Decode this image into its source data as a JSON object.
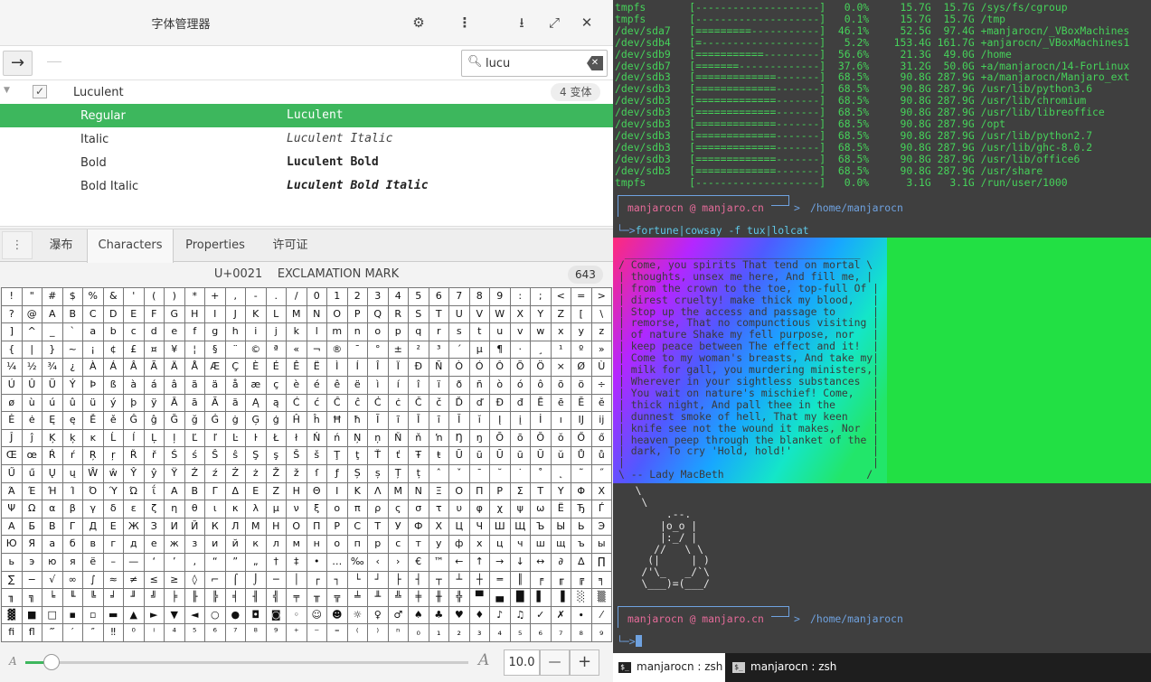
{
  "font_manager": {
    "title": "字体管理器",
    "header_icons": [
      "gear-icon",
      "menu-icon",
      "download-icon",
      "expand-icon",
      "close-icon"
    ],
    "search": {
      "value": "lucu"
    },
    "family": {
      "name": "Luculent",
      "badge": "4 变体",
      "checked": true
    },
    "variants": [
      {
        "style": "Regular",
        "preview": "Luculent",
        "selected": true
      },
      {
        "style": "Italic",
        "preview": "Luculent Italic"
      },
      {
        "style": "Bold",
        "preview": "Luculent Bold"
      },
      {
        "style": "Bold Italic",
        "preview": "Luculent Bold Italic"
      }
    ],
    "tabs": [
      "瀑布",
      "Characters",
      "Properties",
      "许可证"
    ],
    "active_tab": "Characters",
    "char_info": {
      "code": "U+0021",
      "name": "EXCLAMATION MARK",
      "count": "643"
    },
    "chars": [
      "!",
      "\"",
      "#",
      "$",
      "%",
      "&",
      "'",
      "(",
      ")",
      "*",
      "+",
      ",",
      "-",
      ".",
      "/",
      "0",
      "1",
      "2",
      "3",
      "4",
      "5",
      "6",
      "7",
      "8",
      "9",
      ":",
      ";",
      "<",
      "=",
      ">",
      "?",
      "@",
      "A",
      "B",
      "C",
      "D",
      "E",
      "F",
      "G",
      "H",
      "I",
      "J",
      "K",
      "L",
      "M",
      "N",
      "O",
      "P",
      "Q",
      "R",
      "S",
      "T",
      "U",
      "V",
      "W",
      "X",
      "Y",
      "Z",
      "[",
      "\\",
      "]",
      "^",
      "_",
      "`",
      "a",
      "b",
      "c",
      "d",
      "e",
      "f",
      "g",
      "h",
      "i",
      "j",
      "k",
      "l",
      "m",
      "n",
      "o",
      "p",
      "q",
      "r",
      "s",
      "t",
      "u",
      "v",
      "w",
      "x",
      "y",
      "z",
      "{",
      "|",
      "}",
      "~",
      "¡",
      "¢",
      "£",
      "¤",
      "¥",
      "¦",
      "§",
      "¨",
      "©",
      "ª",
      "«",
      "¬",
      "®",
      "¯",
      "°",
      "±",
      "²",
      "³",
      "´",
      "µ",
      "¶",
      "·",
      "¸",
      "¹",
      "º",
      "»",
      "¼",
      "½",
      "¾",
      "¿",
      "À",
      "Á",
      "Â",
      "Ã",
      "Ä",
      "Å",
      "Æ",
      "Ç",
      "È",
      "É",
      "Ê",
      "Ë",
      "Ì",
      "Í",
      "Î",
      "Ï",
      "Ð",
      "Ñ",
      "Ò",
      "Ó",
      "Ô",
      "Õ",
      "Ö",
      "×",
      "Ø",
      "Ù",
      "Ú",
      "Û",
      "Ü",
      "Ý",
      "Þ",
      "ß",
      "à",
      "á",
      "â",
      "ã",
      "ä",
      "å",
      "æ",
      "ç",
      "è",
      "é",
      "ê",
      "ë",
      "ì",
      "í",
      "î",
      "ï",
      "ð",
      "ñ",
      "ò",
      "ó",
      "ô",
      "õ",
      "ö",
      "÷",
      "ø",
      "ù",
      "ú",
      "û",
      "ü",
      "ý",
      "þ",
      "ÿ",
      "Ā",
      "ā",
      "Ă",
      "ă",
      "Ą",
      "ą",
      "Ć",
      "ć",
      "Ĉ",
      "ĉ",
      "Ċ",
      "ċ",
      "Č",
      "č",
      "Ď",
      "ď",
      "Đ",
      "đ",
      "Ē",
      "ē",
      "Ĕ",
      "ĕ",
      "Ė",
      "ė",
      "Ę",
      "ę",
      "Ě",
      "ě",
      "Ĝ",
      "ĝ",
      "Ğ",
      "ğ",
      "Ġ",
      "ġ",
      "Ģ",
      "ģ",
      "Ĥ",
      "ĥ",
      "Ħ",
      "ħ",
      "Ĩ",
      "ĩ",
      "Ī",
      "ī",
      "Ĭ",
      "ĭ",
      "Į",
      "į",
      "İ",
      "ı",
      "Ĳ",
      "ĳ",
      "Ĵ",
      "ĵ",
      "Ķ",
      "ķ",
      "ĸ",
      "Ĺ",
      "ĺ",
      "Ļ",
      "ļ",
      "Ľ",
      "ľ",
      "Ŀ",
      "ŀ",
      "Ł",
      "ł",
      "Ń",
      "ń",
      "Ņ",
      "ņ",
      "Ň",
      "ň",
      "ŉ",
      "Ŋ",
      "ŋ",
      "Ō",
      "ō",
      "Ŏ",
      "ŏ",
      "Ő",
      "ő",
      "Œ",
      "œ",
      "Ŕ",
      "ŕ",
      "Ŗ",
      "ŗ",
      "Ř",
      "ř",
      "Ś",
      "ś",
      "Ŝ",
      "ŝ",
      "Ş",
      "ş",
      "Š",
      "š",
      "Ţ",
      "ţ",
      "Ť",
      "ť",
      "Ŧ",
      "ŧ",
      "Ũ",
      "ũ",
      "Ū",
      "ū",
      "Ŭ",
      "ŭ",
      "Ů",
      "ů",
      "Ű",
      "ű",
      "Ų",
      "ų",
      "Ŵ",
      "ŵ",
      "Ŷ",
      "ŷ",
      "Ÿ",
      "Ź",
      "ź",
      "Ż",
      "ż",
      "Ž",
      "ž",
      "ſ",
      "ƒ",
      "Ș",
      "ș",
      "Ț",
      "ț",
      "ˆ",
      "ˇ",
      "ˉ",
      "˘",
      "˙",
      "˚",
      "˛",
      "˜",
      "˝",
      "Ά",
      "Έ",
      "Ή",
      "Ί",
      "Ό",
      "Ύ",
      "Ώ",
      "ΐ",
      "Α",
      "Β",
      "Γ",
      "Δ",
      "Ε",
      "Ζ",
      "Η",
      "Θ",
      "Ι",
      "Κ",
      "Λ",
      "Μ",
      "Ν",
      "Ξ",
      "Ο",
      "Π",
      "Ρ",
      "Σ",
      "Τ",
      "Υ",
      "Φ",
      "Χ",
      "Ψ",
      "Ω",
      "α",
      "β",
      "γ",
      "δ",
      "ε",
      "ζ",
      "η",
      "θ",
      "ι",
      "κ",
      "λ",
      "μ",
      "ν",
      "ξ",
      "ο",
      "π",
      "ρ",
      "ς",
      "σ",
      "τ",
      "υ",
      "φ",
      "χ",
      "ψ",
      "ω",
      "Ё",
      "Ђ",
      "Ѓ",
      "А",
      "Б",
      "В",
      "Г",
      "Д",
      "Е",
      "Ж",
      "З",
      "И",
      "Й",
      "К",
      "Л",
      "М",
      "Н",
      "О",
      "П",
      "Р",
      "С",
      "Т",
      "У",
      "Ф",
      "Х",
      "Ц",
      "Ч",
      "Ш",
      "Щ",
      "Ъ",
      "Ы",
      "Ь",
      "Э",
      "Ю",
      "Я",
      "а",
      "б",
      "в",
      "г",
      "д",
      "е",
      "ж",
      "з",
      "и",
      "й",
      "к",
      "л",
      "м",
      "н",
      "о",
      "п",
      "р",
      "с",
      "т",
      "у",
      "ф",
      "х",
      "ц",
      "ч",
      "ш",
      "щ",
      "ъ",
      "ы",
      "ь",
      "э",
      "ю",
      "я",
      "ё",
      "–",
      "—",
      "‘",
      "’",
      "‚",
      "“",
      "”",
      "„",
      "†",
      "‡",
      "•",
      "…",
      "‰",
      "‹",
      "›",
      "€",
      "™",
      "←",
      "↑",
      "→",
      "↓",
      "↔",
      "∂",
      "∆",
      "∏",
      "∑",
      "−",
      "√",
      "∞",
      "∫",
      "≈",
      "≠",
      "≤",
      "≥",
      "◊",
      "⌐",
      "⌠",
      "⌡",
      "─",
      "│",
      "┌",
      "┐",
      "└",
      "┘",
      "├",
      "┤",
      "┬",
      "┴",
      "┼",
      "═",
      "║",
      "╒",
      "╓",
      "╔",
      "╕",
      "╖",
      "╗",
      "╘",
      "╙",
      "╚",
      "╛",
      "╜",
      "╝",
      "╞",
      "╟",
      "╠",
      "╡",
      "╢",
      "╣",
      "╤",
      "╥",
      "╦",
      "╧",
      "╨",
      "╩",
      "╪",
      "╫",
      "╬",
      "▀",
      "▄",
      "█",
      "▌",
      "▐",
      "░",
      "▒",
      "▓",
      "■",
      "□",
      "▪",
      "▫",
      "▬",
      "▲",
      "►",
      "▼",
      "◄",
      "○",
      "●",
      "◘",
      "◙",
      "◦",
      "☺",
      "☻",
      "☼",
      "♀",
      "♂",
      "♠",
      "♣",
      "♥",
      "♦",
      "♪",
      "♫",
      "✓",
      "✗",
      "∙",
      "⁄",
      "ﬁ",
      "ﬂ",
      "‴",
      "′",
      "″",
      "‼",
      "⁰",
      "ⁱ",
      "⁴",
      "⁵",
      "⁶",
      "⁷",
      "⁸",
      "⁹",
      "⁺",
      "⁻",
      "⁼",
      "⁽",
      "⁾",
      "ⁿ",
      "₀",
      "₁",
      "₂",
      "₃",
      "₄",
      "₅",
      "₆",
      "₇",
      "₈",
      "₉"
    ],
    "zoom": {
      "value": "10.0",
      "min_label": "A",
      "max_label": "A",
      "minus": "—",
      "plus": "+",
      "level": 0.06
    }
  },
  "terminal": {
    "df_lines": [
      "tmpfs       [--------------------]   0.0%     15.7G  15.7G /sys/fs/cgroup",
      "tmpfs       [--------------------]   0.1%     15.7G  15.7G /tmp",
      "/dev/sda7   [=========-----------]  46.1%     52.5G  97.4G +manjarocn/_VBoxMachines",
      "/dev/sdb4   [=-------------------]   5.2%    153.4G 161.7G +anjarocn/_VBoxMachines1",
      "/dev/sdb9   [===========---------]  56.6%     21.3G  49.0G /home",
      "/dev/sdb7   [=======-------------]  37.6%     31.2G  50.0G +a/manjarocn/14-ForLinux",
      "/dev/sdb3   [=============-------]  68.5%     90.8G 287.9G +a/manjarocn/Manjaro_ext",
      "/dev/sdb3   [=============-------]  68.5%     90.8G 287.9G /usr/lib/python3.6",
      "/dev/sdb3   [=============-------]  68.5%     90.8G 287.9G /usr/lib/chromium",
      "/dev/sdb3   [=============-------]  68.5%     90.8G 287.9G /usr/lib/libreoffice",
      "/dev/sdb3   [=============-------]  68.5%     90.8G 287.9G /opt",
      "/dev/sdb3   [=============-------]  68.5%     90.8G 287.9G /usr/lib/python2.7",
      "/dev/sdb3   [=============-------]  68.5%     90.8G 287.9G /usr/lib/ghc-8.0.2",
      "/dev/sdb3   [=============-------]  68.5%     90.8G 287.9G /usr/lib/office6",
      "/dev/sdb3   [=============-------]  68.5%     90.8G 287.9G /usr/share",
      "tmpfs       [--------------------]   0.0%      3.1G   3.1G /run/user/1000"
    ],
    "prompt_user": "manjarocn @ manjaro.cn",
    "prompt_path": "/home/manjarocn",
    "prompt_arrow": ">",
    "command": "fortune|cowsay -f tux|lolcat",
    "cmd_prefix": "└─>",
    "quote_lines": [
      " ______________________________________",
      "/ Come, you spirits That tend on mortal \\",
      "| thoughts, unsex me here, And fill me, |",
      "| from the crown to the toe, top-full Of |",
      "| direst cruelty! make thick my blood,   |",
      "| Stop up the access and passage to      |",
      "| remorse, That no compunctious visiting |",
      "| of nature Shake my fell purpose, nor   |",
      "| keep peace between The effect and it!  |",
      "| Come to my woman's breasts, And take my|",
      "| milk for gall, you murdering ministers,|",
      "| Wherever in your sightless substances  |",
      "| You wait on nature's mischief! Come,   |",
      "| thick night, And pall thee in the      |",
      "| dunnest smoke of hell, That my keen    |",
      "| knife see not the wound it makes, Nor  |",
      "| heaven peep through the blanket of the |",
      "| dark, To cry 'Hold, hold!'             |",
      "|                                        |",
      "\\ -- Lady MacBeth                       /",
      " ----------------------------------------"
    ],
    "tux": "   \\\n    \\\n        .--.\n       |o_o |\n       |:_/ |\n      //   \\ \\\n     (|     | )\n    /'\\_   _/`\\\n    \\___)=(___/",
    "tabs": [
      {
        "label": "manjarocn : zsh",
        "active": true
      },
      {
        "label": "manjarocn : zsh",
        "active": false
      }
    ],
    "colors": {
      "green": "#46d25a",
      "blue": "#6fa2e0",
      "pink": "#e66b9a",
      "bg": "#3f3f3f"
    }
  }
}
